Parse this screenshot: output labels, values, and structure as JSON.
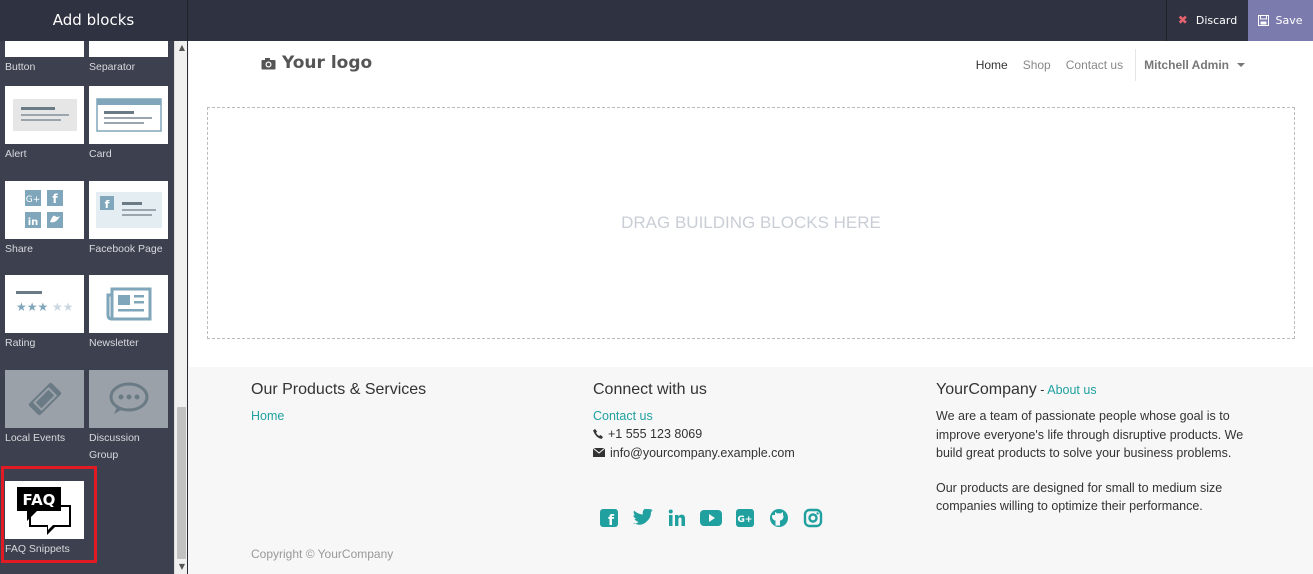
{
  "topbar": {
    "panel_title": "Add blocks",
    "discard_label": "Discard",
    "save_label": "Save"
  },
  "sidebar": {
    "blocks": [
      {
        "label": "Button"
      },
      {
        "label": "Separator"
      },
      {
        "label": "Alert"
      },
      {
        "label": "Card"
      },
      {
        "label": "Share"
      },
      {
        "label": "Facebook Page"
      },
      {
        "label": "Rating"
      },
      {
        "label": "Newsletter"
      },
      {
        "label": "Local Events"
      },
      {
        "label": "Discussion Group"
      },
      {
        "label": "FAQ Snippets"
      }
    ],
    "faq_thumb_text": "FAQ"
  },
  "header": {
    "logo": "Your logo",
    "nav": [
      "Home",
      "Shop",
      "Contact us"
    ],
    "user": "Mitchell Admin"
  },
  "dropzone": {
    "text": "DRAG BUILDING BLOCKS HERE"
  },
  "footer": {
    "col1": {
      "title": "Our Products & Services",
      "link": "Home"
    },
    "col2": {
      "title": "Connect with us",
      "link": "Contact us",
      "phone": "+1 555 123 8069",
      "email": "info@yourcompany.example.com"
    },
    "col3": {
      "title": "YourCompany",
      "title_sep": " - ",
      "about": "About us",
      "p1": "We are a team of passionate people whose goal is to improve everyone's life through disruptive products. We build great products to solve your business problems.",
      "p2": "Our products are designed for small to medium size companies willing to optimize their performance."
    },
    "social_icons": [
      "facebook-icon",
      "twitter-icon",
      "linkedin-icon",
      "youtube-icon",
      "google-plus-icon",
      "github-icon",
      "instagram-icon"
    ],
    "copyright": "Copyright © YourCompany"
  },
  "colors": {
    "accent": "#21a0a0",
    "topbar": "#2f3240",
    "save": "#7c7bad",
    "highlight": "#e01b24"
  }
}
